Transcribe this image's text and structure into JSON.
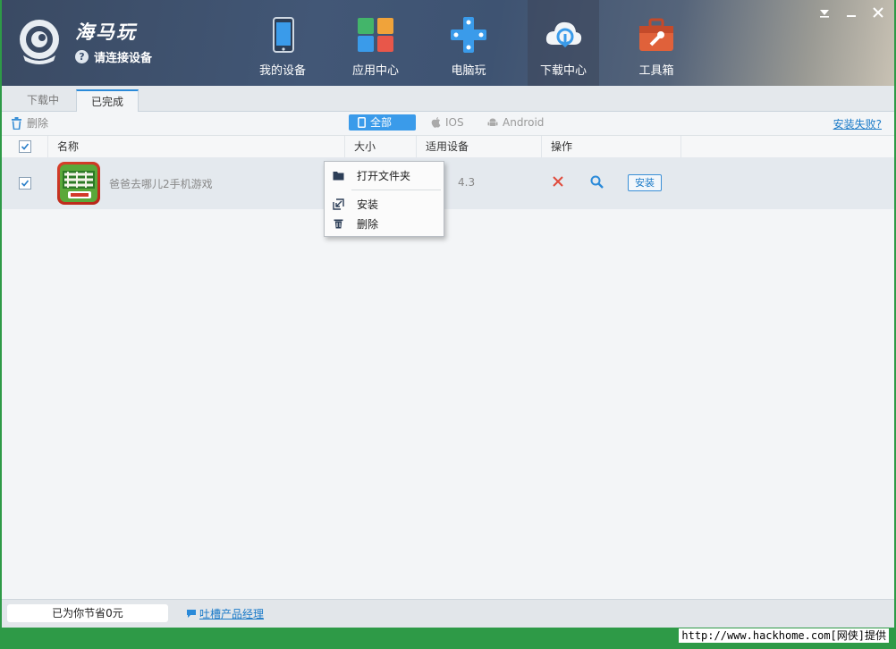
{
  "app": {
    "brand": "海马玩",
    "connect_prompt": "请连接设备",
    "connect_icon": "question-icon"
  },
  "nav": [
    {
      "label": "我的设备",
      "icon": "device-icon"
    },
    {
      "label": "应用中心",
      "icon": "apps-icon"
    },
    {
      "label": "电脑玩",
      "icon": "gamepad-icon"
    },
    {
      "label": "下载中心",
      "icon": "cloud-download-icon",
      "active": true
    },
    {
      "label": "工具箱",
      "icon": "toolbox-icon"
    }
  ],
  "tabs": {
    "downloading": "下载中",
    "completed": "已完成"
  },
  "toolbar": {
    "delete_label": "删除",
    "filters": [
      "全部",
      "IOS",
      "Android"
    ],
    "install_fail_link": "安装失败?"
  },
  "table": {
    "headers": {
      "name": "名称",
      "size": "大小",
      "device": "适用设备",
      "actions": "操作"
    },
    "rows": [
      {
        "name": "爸爸去哪儿2手机游戏",
        "device": "4.3",
        "install_label": "安装",
        "checked": true
      }
    ]
  },
  "context_menu": {
    "items": [
      {
        "label": "打开文件夹",
        "icon": "folder-icon"
      },
      {
        "label": "安装",
        "icon": "install-icon"
      },
      {
        "label": "删除",
        "icon": "trash-icon"
      }
    ]
  },
  "status": {
    "saved_text": "已为你节省0元",
    "feedback_link": "吐槽产品经理"
  },
  "watermark": "http://www.hackhome.com[网侠]提供",
  "colors": {
    "accent": "#3a9bea",
    "link": "#1a7ac8",
    "delete_red": "#e04b3c",
    "header_bg": "#425776",
    "bottom_band": "#2e9a47"
  }
}
